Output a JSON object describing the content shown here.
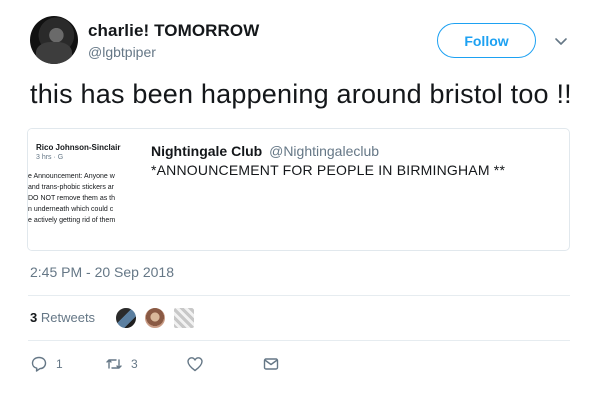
{
  "user": {
    "display_name": "charlie! TOMORROW",
    "handle": "@lgbtpiper",
    "follow_label": "Follow"
  },
  "tweet": {
    "text": "this has been happening around bristol too !!",
    "timestamp": "2:45 PM - 20 Sep 2018"
  },
  "quoted": {
    "author_name": "Nightingale Club",
    "author_handle": "@Nightingaleclub",
    "text": "*ANNOUNCEMENT FOR PEOPLE IN BIRMINGHAM **",
    "thumbnail": {
      "name": "Rico Johnson-Sinclair",
      "time": "3 hrs · G",
      "lines": [
        "e Announcement: Anyone w",
        "and trans-phobic stickers ar",
        "DO NOT remove them as th",
        "n underneath which could c",
        "e actively getting rid of them"
      ]
    }
  },
  "stats": {
    "retweets_count": "3",
    "retweets_label": "Retweets"
  },
  "actions": {
    "reply_count": "1",
    "retweet_count": "3"
  },
  "colors": {
    "accent": "#1da1f2",
    "secondary_text": "#657786",
    "border": "#e1e8ed"
  }
}
